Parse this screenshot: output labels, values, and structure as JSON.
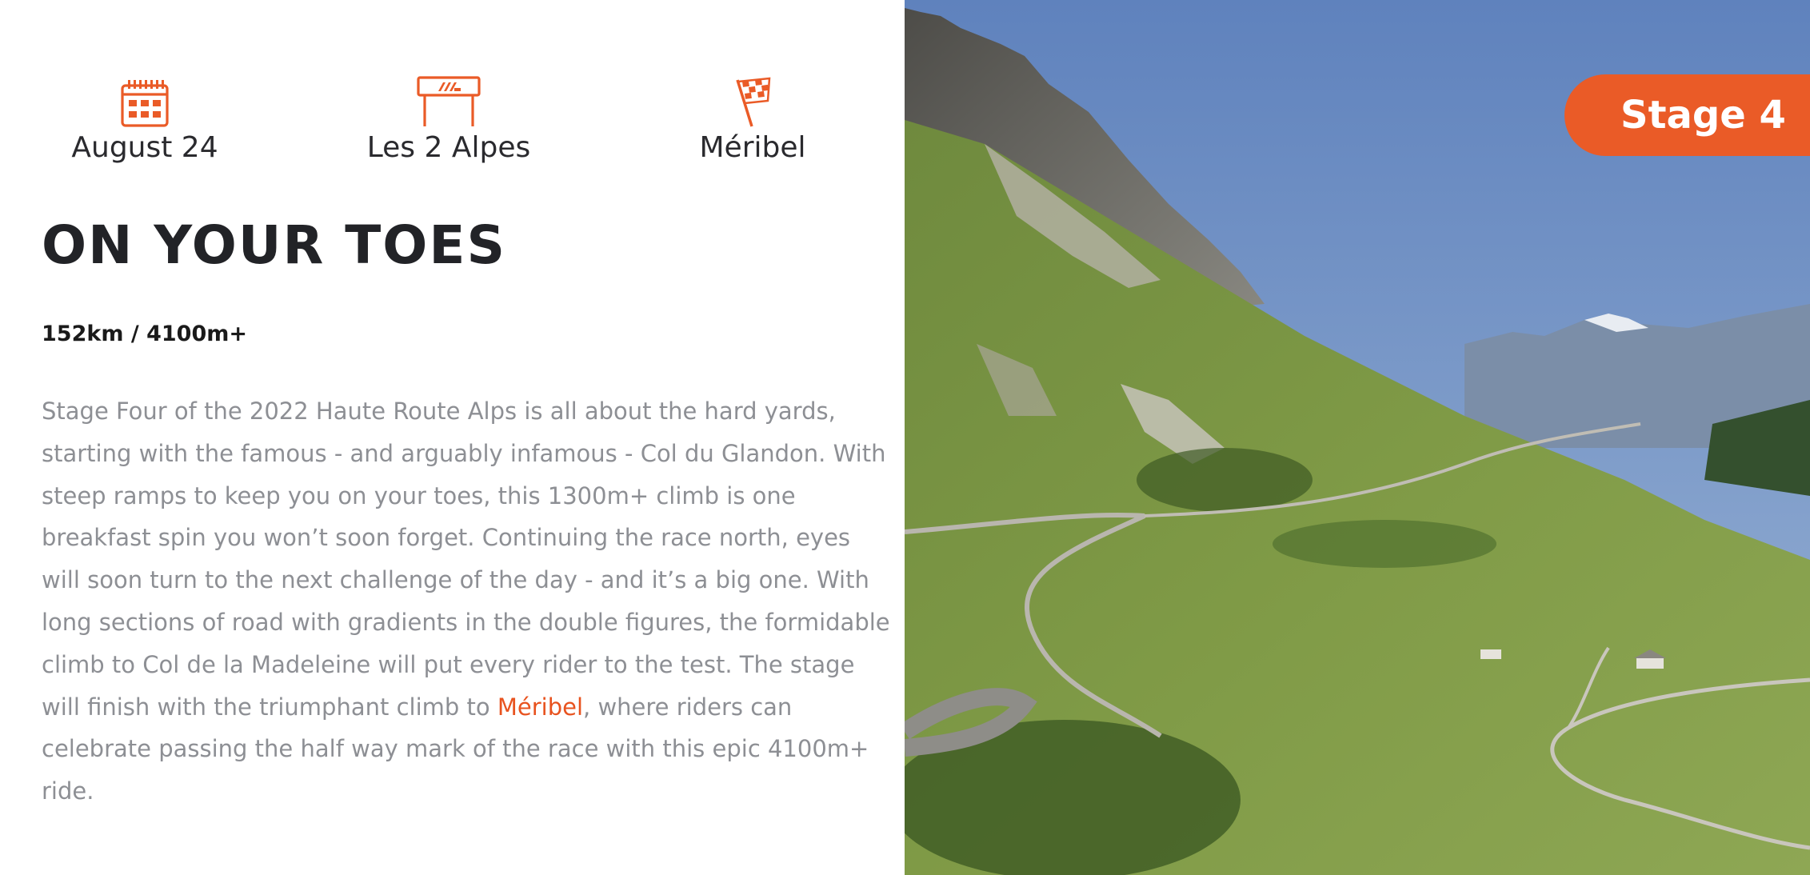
{
  "colors": {
    "accent": "#ea5b27",
    "heading": "#222327",
    "body_text": "#8d8f94"
  },
  "info": {
    "date": {
      "icon": "calendar-icon",
      "label": "August 24"
    },
    "start": {
      "icon": "start-banner-icon",
      "label": "Les 2 Alpes"
    },
    "finish": {
      "icon": "checkered-flag-icon",
      "label": "Méribel"
    }
  },
  "stage": {
    "title": "ON YOUR TOES",
    "stats": "152km / 4100m+",
    "description_before_link": "Stage Four of the 2022 Haute Route Alps is all about the hard yards, starting with the famous - and arguably infamous - Col du Glandon. With steep ramps to keep you on your toes, this 1300m+ climb is one breakfast spin you won’t soon forget. Continuing the race north, eyes will soon turn to the next challenge of the day - and it’s a big one. With long sections of road with gradients in the double figures, the formidable climb to Col de la Madeleine will put every rider to the test. The stage will finish with the triumphant climb to ",
    "description_link": "Méribel",
    "description_after_link": ", where riders can celebrate passing the half way mark of the race with this epic 4100m+ ride."
  },
  "badge": {
    "label": "Stage 4"
  }
}
